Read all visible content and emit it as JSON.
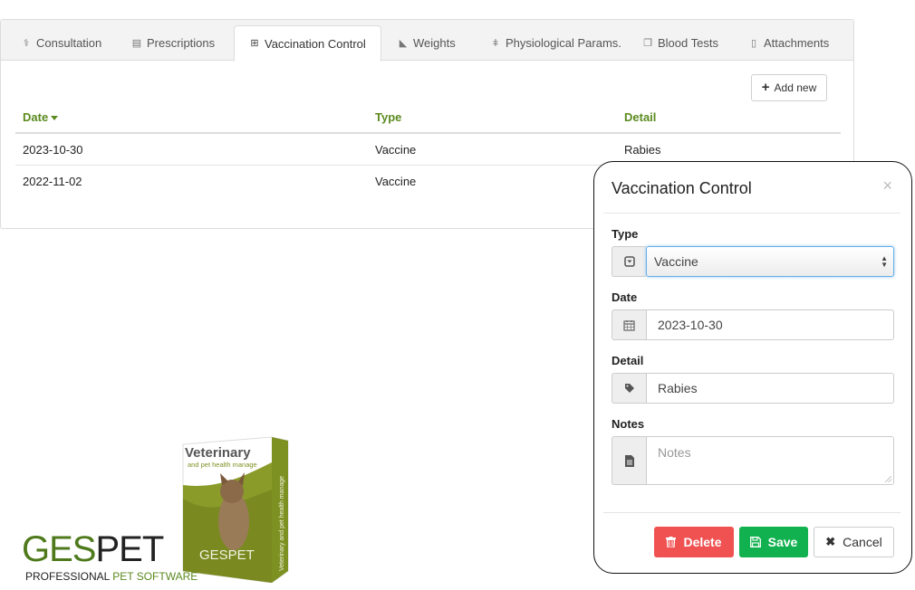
{
  "tabs": [
    {
      "label": "Consultation",
      "icon": "stethoscope-icon",
      "glyph": "⚕",
      "active": false
    },
    {
      "label": "Prescriptions",
      "icon": "prescription-card-icon",
      "glyph": "▤",
      "active": false
    },
    {
      "label": "Vaccination Control",
      "icon": "medkit-icon",
      "glyph": "⊞",
      "active": true
    },
    {
      "label": "Weights",
      "icon": "area-chart-icon",
      "glyph": "◣",
      "active": false
    },
    {
      "label": "Physiological Params.",
      "icon": "thermometer-icon",
      "glyph": "🌡",
      "active": false
    },
    {
      "label": "Blood Tests",
      "icon": "copy-document-icon",
      "glyph": "❐",
      "active": false
    },
    {
      "label": "Attachments",
      "icon": "file-attachment-icon",
      "glyph": "🗎",
      "active": false
    }
  ],
  "toolbar": {
    "add_new_label": "Add new",
    "add_icon": "+"
  },
  "table": {
    "columns": [
      {
        "label": "Date",
        "sorted": "desc"
      },
      {
        "label": "Type"
      },
      {
        "label": "Detail"
      }
    ],
    "rows": [
      {
        "date": "2023-10-30",
        "type": "Vaccine",
        "detail": "Rabies"
      },
      {
        "date": "2022-11-02",
        "type": "Vaccine",
        "detail": ""
      }
    ]
  },
  "brand": {
    "logo_part1": "GES",
    "logo_part2": "PET",
    "tagline_part1": "PROFESSIONAL ",
    "tagline_part2": "PET SOFTWARE",
    "box_title": "Veterinary",
    "box_subtitle": "and pet health manage",
    "box_side": "Veterinary and pet health manage",
    "box_logo": "GESPET",
    "colors": {
      "green": "#5b8a1f",
      "dark_green": "#4f7a1c"
    }
  },
  "modal": {
    "title": "Vaccination Control",
    "close": "×",
    "fields": {
      "type": {
        "label": "Type",
        "value": "Vaccine"
      },
      "date": {
        "label": "Date",
        "value": "2023-10-30"
      },
      "detail": {
        "label": "Detail",
        "value": "Rabies"
      },
      "notes": {
        "label": "Notes",
        "placeholder": "Notes",
        "value": ""
      }
    },
    "buttons": {
      "delete": "Delete",
      "save": "Save",
      "cancel": "Cancel"
    },
    "colors": {
      "delete": "#f05252",
      "save": "#11b14f",
      "focus": "#66afe9"
    }
  }
}
